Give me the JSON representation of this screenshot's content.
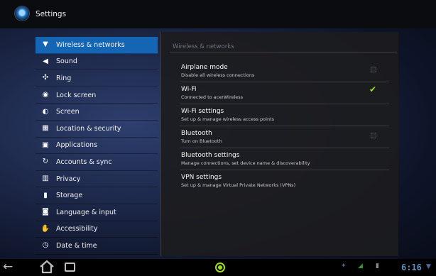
{
  "titlebar": {
    "title": "Settings",
    "icon": "settings-icon"
  },
  "sidebar": {
    "items": [
      {
        "label": "Wireless & networks",
        "icon": "wifi-icon",
        "active": true
      },
      {
        "label": "Sound",
        "icon": "speaker-icon"
      },
      {
        "label": "Ring",
        "icon": "ring-icon"
      },
      {
        "label": "Lock screen",
        "icon": "lock-icon"
      },
      {
        "label": "Screen",
        "icon": "screen-icon"
      },
      {
        "label": "Location & security",
        "icon": "location-grid-icon"
      },
      {
        "label": "Applications",
        "icon": "applications-icon"
      },
      {
        "label": "Accounts & sync",
        "icon": "sync-icon"
      },
      {
        "label": "Privacy",
        "icon": "privacy-icon"
      },
      {
        "label": "Storage",
        "icon": "storage-icon"
      },
      {
        "label": "Language & input",
        "icon": "language-icon"
      },
      {
        "label": "Accessibility",
        "icon": "accessibility-icon"
      },
      {
        "label": "Date & time",
        "icon": "clock-icon"
      }
    ]
  },
  "panel": {
    "header": "Wireless & networks",
    "rows": [
      {
        "title": "Airplane mode",
        "summary": "Disable all wireless connections",
        "checkbox": true,
        "checked": false
      },
      {
        "title": "Wi-Fi",
        "summary": "Connected to acerWireless",
        "checkbox": true,
        "checked": true
      },
      {
        "title": "Wi-Fi settings",
        "summary": "Set up & manage wireless access points",
        "checkbox": false
      },
      {
        "title": "Bluetooth",
        "summary": "Turn on Bluetooth",
        "checkbox": true,
        "checked": false
      },
      {
        "title": "Bluetooth settings",
        "summary": "Manage connections, set device name & discoverability",
        "checkbox": false
      },
      {
        "title": "VPN settings",
        "summary": "Set up & manage Virtual Private Networks (VPNs)",
        "checkbox": false
      }
    ]
  },
  "navbar": {
    "clock": "6:16",
    "accent": "#9ee11b",
    "clock_color": "#5d8fbf"
  }
}
